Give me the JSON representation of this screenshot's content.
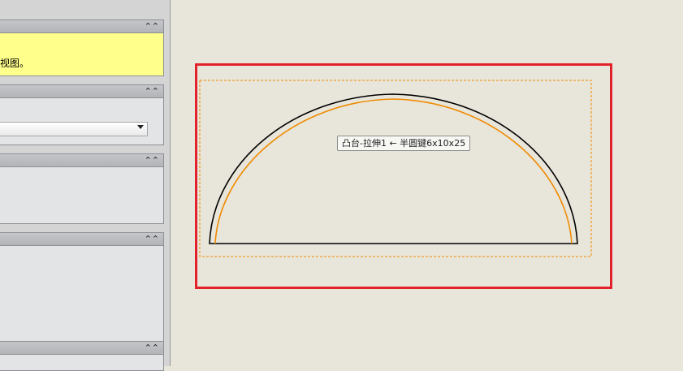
{
  "property_panel": {
    "message": {
      "text": "视图。",
      "collapse_icon": "chevron-double-up-icon"
    },
    "selection": {
      "dropdown_value": ""
    }
  },
  "graphics": {
    "tooltip": "凸台-拉伸1 ← 半圆键6x10x25",
    "colors": {
      "highlight": "#e3212a",
      "edge": "#000000",
      "preview_edge": "#f08a00",
      "background": "#e8e5da"
    }
  }
}
